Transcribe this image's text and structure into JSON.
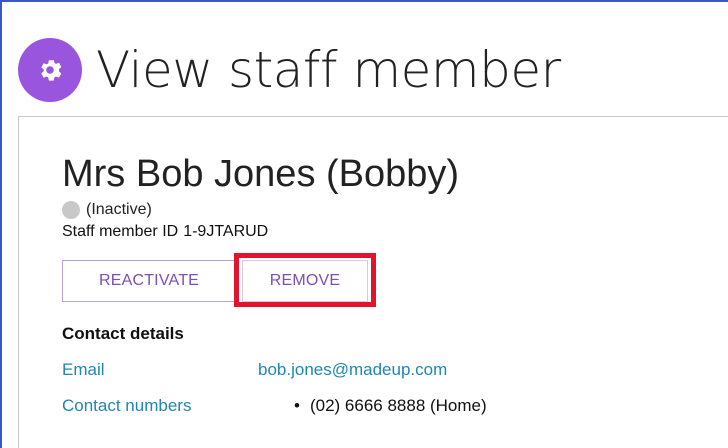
{
  "page": {
    "title": "View staff member",
    "icon": "gear-icon",
    "accent_color": "#9a55df"
  },
  "staff": {
    "display_name": "Mrs Bob Jones (Bobby)",
    "status": "(Inactive)",
    "status_color": "#c8c8c8",
    "id_label": "Staff member ID",
    "id_value": "1-9JTARUD"
  },
  "actions": {
    "reactivate_label": "REACTIVATE",
    "remove_label": "REMOVE",
    "highlight_color": "#e2142d"
  },
  "contact": {
    "section_title": "Contact details",
    "email_label": "Email",
    "email_value": "bob.jones@madeup.com",
    "numbers_label": "Contact numbers",
    "numbers": [
      "(02) 6666 8888 (Home)"
    ]
  }
}
